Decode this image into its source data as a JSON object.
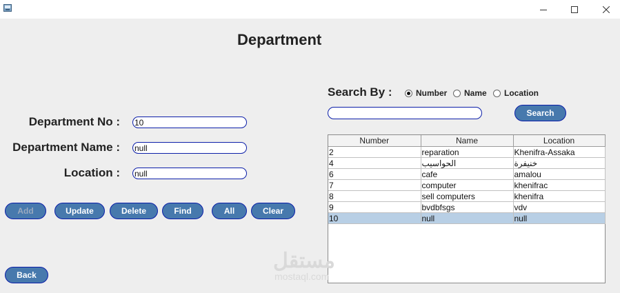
{
  "window": {
    "title": ""
  },
  "form": {
    "title": "Department",
    "labels": {
      "number": "Department No :",
      "name": "Department Name :",
      "location": "Location :"
    },
    "values": {
      "number": "10",
      "name": "null",
      "location": "null"
    }
  },
  "buttons": {
    "add": "Add",
    "update": "Update",
    "delete": "Delete",
    "find": "Find",
    "all": "All",
    "clear": "Clear",
    "back": "Back"
  },
  "search": {
    "label": "Search By :",
    "options": [
      "Number",
      "Name",
      "Location"
    ],
    "selected": "Number",
    "value": "",
    "button": "Search"
  },
  "table": {
    "columns": [
      "Number",
      "Name",
      "Location"
    ],
    "rows": [
      [
        "2",
        "reparation",
        "Khenifra-Assaka"
      ],
      [
        "4",
        "الحواسيب",
        "خنيفرة"
      ],
      [
        "6",
        "cafe",
        "amalou"
      ],
      [
        "7",
        "computer",
        "khenifrac"
      ],
      [
        "8",
        "sell computers",
        "khenifra"
      ],
      [
        "9",
        "bvdbfsgs",
        "vdv"
      ],
      [
        "10",
        "null",
        "null"
      ]
    ],
    "selected_row": 6
  },
  "watermark": {
    "arabic": "مستقل",
    "latin": "mostaql.com"
  },
  "colors": {
    "button_fill": "#4779ad",
    "button_border": "#0a1da8",
    "selected_row": "#b8cfe5",
    "background": "#eeeeee"
  }
}
